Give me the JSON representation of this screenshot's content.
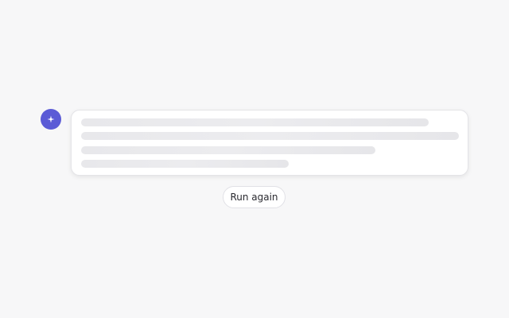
{
  "assistant": {
    "avatar_icon": "sparkle-icon",
    "accent_color": "#5b5bd6"
  },
  "message": {
    "state": "loading",
    "skeleton_line_count": 4
  },
  "actions": {
    "run_again_label": "Run again"
  }
}
